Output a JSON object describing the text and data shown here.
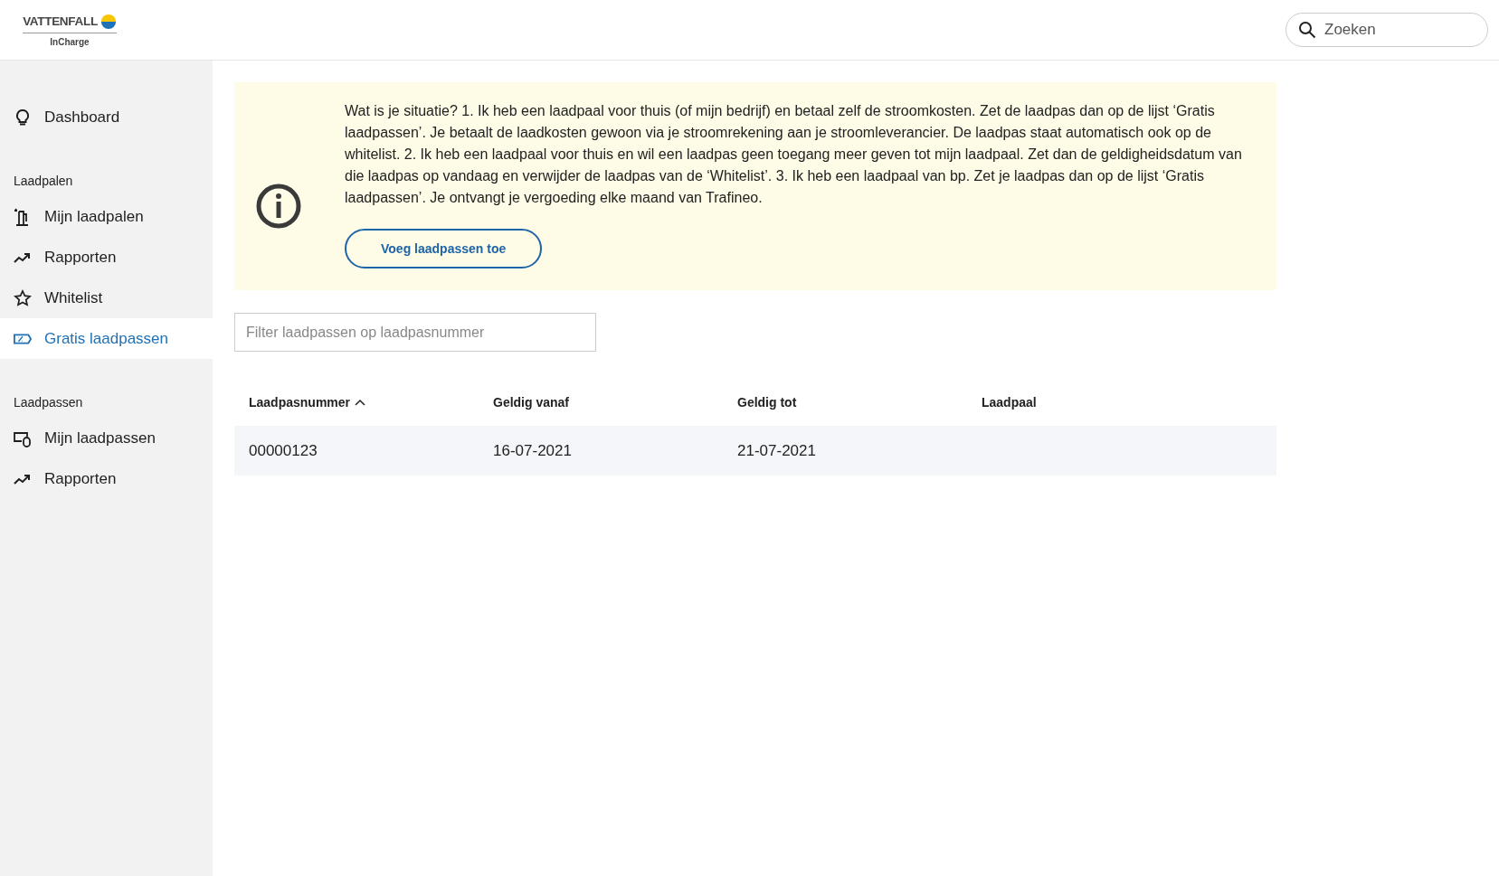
{
  "header": {
    "logo": {
      "brand": "VATTENFALL",
      "product": "InCharge"
    },
    "search": {
      "placeholder": "Zoeken"
    }
  },
  "sidebar": {
    "items": [
      {
        "label": "Dashboard",
        "selected": false
      }
    ],
    "sections": [
      {
        "heading": "Laadpalen",
        "items": [
          {
            "label": "Mijn laadpalen",
            "selected": false
          },
          {
            "label": "Rapporten",
            "selected": false
          },
          {
            "label": "Whitelist",
            "selected": false
          },
          {
            "label": "Gratis laadpassen",
            "selected": true
          }
        ]
      },
      {
        "heading": "Laadpassen",
        "items": [
          {
            "label": "Mijn laadpassen",
            "selected": false
          },
          {
            "label": "Rapporten",
            "selected": false
          }
        ]
      }
    ]
  },
  "info": {
    "text": "Wat is je situatie? 1. Ik heb een laadpaal voor thuis (of mijn bedrijf) en betaal zelf de stroomkosten. Zet de laadpas dan op de lijst ‘Gratis laadpassen’. Je betaalt de laadkosten gewoon via je stroomrekening aan je stroomleverancier. De laadpas staat automatisch ook op de whitelist. 2. Ik heb een laadpaal voor thuis en wil een laadpas geen toegang meer geven tot mijn laadpaal. Zet dan de geldigheidsdatum van die laadpas op vandaag en verwijder de laadpas van de ‘Whitelist’. 3. Ik heb een laadpaal van bp. Zet je laadpas dan op de lijst ‘Gratis laadpassen’. Je ontvangt je vergoeding elke maand van Trafineo.",
    "button": "Voeg laadpassen toe"
  },
  "filter": {
    "placeholder": "Filter laadpassen op laadpasnummer"
  },
  "table": {
    "columns": [
      {
        "label": "Laadpasnummer",
        "sorted": true
      },
      {
        "label": "Geldig vanaf",
        "sorted": false
      },
      {
        "label": "Geldig tot",
        "sorted": false
      },
      {
        "label": "Laadpaal",
        "sorted": false
      }
    ],
    "rows": [
      [
        "00000123",
        "16-07-2021",
        "21-07-2021"
      ]
    ]
  }
}
